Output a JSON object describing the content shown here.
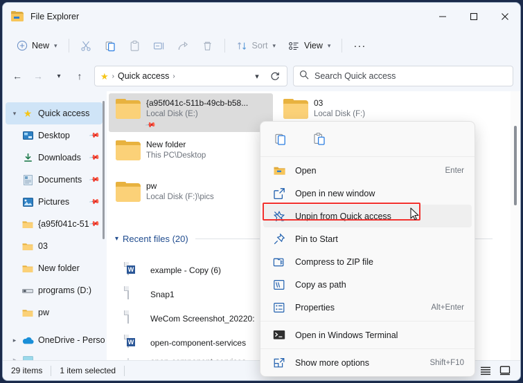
{
  "window": {
    "title": "File Explorer",
    "app_icon": "folder-icon",
    "minimize": "minimize-icon",
    "maximize": "maximize-icon",
    "close": "close-icon"
  },
  "commandbar": {
    "new_label": "New",
    "sort_label": "Sort",
    "view_label": "View",
    "more_label": "···",
    "items": [
      {
        "name": "cut",
        "icon": "scissors-icon"
      },
      {
        "name": "copy",
        "icon": "copy-icon"
      },
      {
        "name": "paste",
        "icon": "paste-icon"
      },
      {
        "name": "rename",
        "icon": "rename-icon"
      },
      {
        "name": "share",
        "icon": "share-icon"
      },
      {
        "name": "delete",
        "icon": "trash-icon"
      }
    ]
  },
  "addressbar": {
    "back": "back-arrow-icon",
    "forward": "forward-arrow-icon",
    "recent_dropdown": "chevron-down-icon",
    "up": "up-arrow-icon",
    "crumb_icon": "star-icon",
    "crumb": "Quick access",
    "crumb_separator": "›",
    "dropdown": "chevron-down-icon",
    "refresh": "refresh-icon"
  },
  "search": {
    "icon": "search-icon",
    "placeholder": "Search Quick access"
  },
  "sidebar": {
    "items": [
      {
        "label": "Quick access",
        "icon": "star-icon",
        "twisty": "v",
        "selected": true,
        "indent": false,
        "pinned": false
      },
      {
        "label": "Desktop",
        "icon": "desktop-icon",
        "indent": true,
        "pinned": true
      },
      {
        "label": "Downloads",
        "icon": "download-icon",
        "indent": true,
        "pinned": true
      },
      {
        "label": "Documents",
        "icon": "documents-icon",
        "indent": true,
        "pinned": true
      },
      {
        "label": "Pictures",
        "icon": "pictures-icon",
        "indent": true,
        "pinned": true
      },
      {
        "label": "{a95f041c-51",
        "icon": "folder-icon",
        "indent": true,
        "pinned": true
      },
      {
        "label": "03",
        "icon": "folder-icon",
        "indent": true,
        "pinned": false
      },
      {
        "label": "New folder",
        "icon": "folder-icon",
        "indent": true,
        "pinned": false
      },
      {
        "label": "programs (D:)",
        "icon": "drive-icon",
        "indent": true,
        "pinned": false
      },
      {
        "label": "pw",
        "icon": "folder-icon",
        "indent": true,
        "pinned": false
      },
      {
        "label": "OneDrive - Perso",
        "icon": "onedrive-icon",
        "twisty": ">",
        "indent": false,
        "pinned": false
      }
    ]
  },
  "main": {
    "tiles": [
      {
        "name": "{a95f041c-511b-49cb-b58...",
        "sub": "Local Disk (E:)",
        "icon": "folder-icon",
        "selected": true,
        "pinned": true
      },
      {
        "name": "03",
        "sub": "Local Disk (F:)",
        "icon": "folder-icon",
        "selected": false,
        "pinned": false
      },
      {
        "name": "New folder",
        "sub": "This PC\\Desktop",
        "icon": "folder-icon",
        "selected": false,
        "pinned": false
      },
      {
        "name": "pw",
        "sub": "Local Disk (F:)\\pics",
        "icon": "folder-icon",
        "selected": false,
        "pinned": false
      }
    ],
    "recent_section": {
      "chevron": "chevron-down-icon",
      "title": "Recent files (20)"
    },
    "recent_files": [
      {
        "name": "example - Copy (6)",
        "icon": "word-document-icon"
      },
      {
        "name": "Snap1",
        "icon": "document-icon"
      },
      {
        "name": "WeCom Screenshot_20220:",
        "icon": "document-icon"
      },
      {
        "name": "open-component-services",
        "icon": "word-document-icon"
      },
      {
        "name": "open-component-services",
        "icon": "document-icon"
      }
    ]
  },
  "context_menu": {
    "toolbar": [
      {
        "name": "copy",
        "icon": "copy-icon"
      },
      {
        "name": "paste",
        "icon": "paste-icon"
      }
    ],
    "items": [
      {
        "label": "Open",
        "accel": "Enter",
        "icon": "folder-icon",
        "highlighted": false
      },
      {
        "label": "Open in new window",
        "accel": "",
        "icon": "open-new-window-icon",
        "highlighted": false
      },
      {
        "label": "Unpin from Quick access",
        "accel": "",
        "icon": "unpin-star-icon",
        "highlighted": true
      },
      {
        "label": "Pin to Start",
        "accel": "",
        "icon": "pin-icon",
        "highlighted": false
      },
      {
        "label": "Compress to ZIP file",
        "accel": "",
        "icon": "zip-icon",
        "highlighted": false
      },
      {
        "label": "Copy as path",
        "accel": "",
        "icon": "copy-path-icon",
        "highlighted": false
      },
      {
        "label": "Properties",
        "accel": "Alt+Enter",
        "icon": "properties-icon",
        "highlighted": false
      },
      {
        "label": "Open in Windows Terminal",
        "accel": "",
        "icon": "terminal-icon",
        "highlighted": false
      },
      {
        "label": "Show more options",
        "accel": "Shift+F10",
        "icon": "show-more-icon",
        "highlighted": false
      }
    ],
    "highlight_color": "#f2302d"
  },
  "statusbar": {
    "items_count": "29 items",
    "selection": "1 item selected",
    "view_details": "details-view-icon",
    "view_tiles": "large-icons-view-icon"
  }
}
